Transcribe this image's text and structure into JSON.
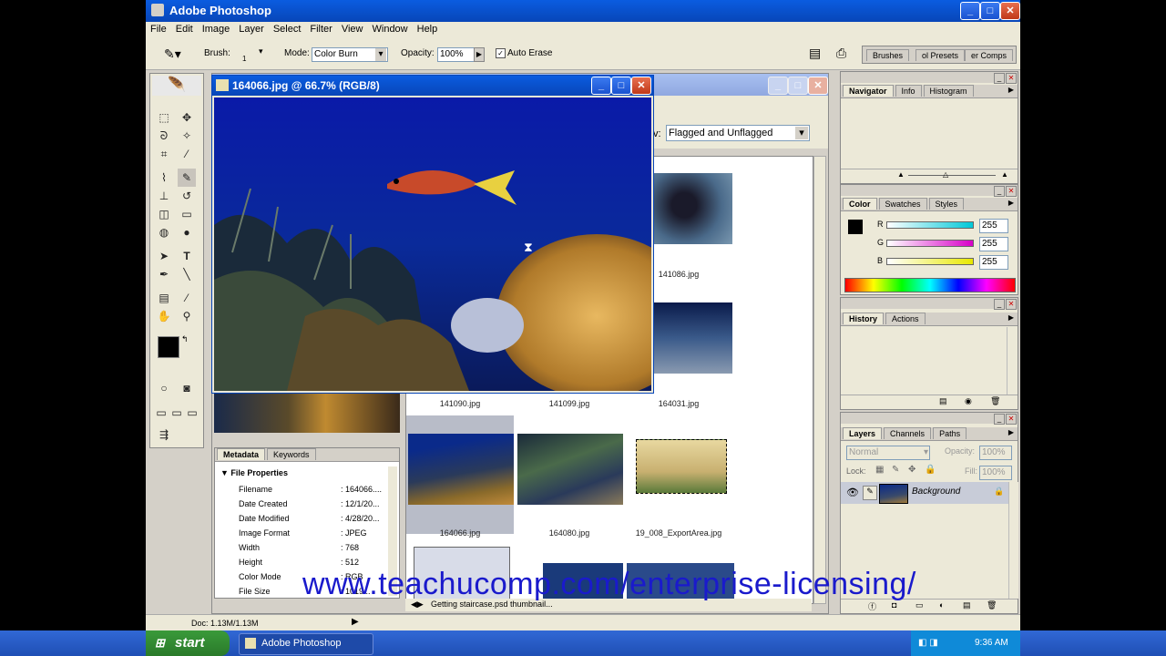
{
  "app": {
    "title": "Adobe Photoshop"
  },
  "menu": [
    "File",
    "Edit",
    "Image",
    "Layer",
    "Select",
    "Filter",
    "View",
    "Window",
    "Help"
  ],
  "options": {
    "brush_label": "Brush:",
    "brush_size": "1",
    "mode_label": "Mode:",
    "mode_value": "Color Burn",
    "opacity_label": "Opacity:",
    "opacity_value": "100%",
    "auto_erase": "Auto Erase",
    "wells": [
      "Brushes",
      "ol Presets",
      "er Comps"
    ]
  },
  "document": {
    "title": "164066.jpg @ 66.7% (RGB/8)"
  },
  "browser": {
    "filter_label": "v:",
    "filter_value": "Flagged and Unflagged",
    "thumbs": [
      {
        "name": "141086.jpg"
      },
      {
        "name": "141090.jpg"
      },
      {
        "name": "141099.jpg"
      },
      {
        "name": "164031.jpg"
      },
      {
        "name": "164066.jpg"
      },
      {
        "name": "164080.jpg"
      },
      {
        "name": "19_008_ExportArea.jpg"
      }
    ],
    "status": "Getting staircase.psd thumbnail..."
  },
  "metadata": {
    "tabs": [
      "Metadata",
      "Keywords"
    ],
    "section": "File Properties",
    "rows": [
      {
        "k": "Filename",
        "v": ": 164066...."
      },
      {
        "k": "Date Created",
        "v": ": 12/1/20..."
      },
      {
        "k": "Date Modified",
        "v": ": 4/28/20..."
      },
      {
        "k": "Image Format",
        "v": ": JPEG"
      },
      {
        "k": "Width",
        "v": ": 768"
      },
      {
        "k": "Height",
        "v": ": 512"
      },
      {
        "k": "Color Mode",
        "v": ": RGB"
      },
      {
        "k": "File Size",
        "v": ": 1019..."
      }
    ]
  },
  "navigator": {
    "tabs": [
      "Navigator",
      "Info",
      "Histogram"
    ]
  },
  "color": {
    "tabs": [
      "Color",
      "Swatches",
      "Styles"
    ],
    "channels": [
      {
        "name": "R",
        "value": "255",
        "color": "#00c8d8"
      },
      {
        "name": "G",
        "value": "255",
        "color": "#d800c8"
      },
      {
        "name": "B",
        "value": "255",
        "color": "#e8e800"
      }
    ]
  },
  "history": {
    "tabs": [
      "History",
      "Actions"
    ]
  },
  "layers": {
    "tabs": [
      "Layers",
      "Channels",
      "Paths"
    ],
    "blend": "Normal",
    "opacity_label": "Opacity:",
    "opacity_value": "100%",
    "lock_label": "Lock:",
    "fill_label": "Fill:",
    "fill_value": "100%",
    "layer_name": "Background"
  },
  "statusbar": {
    "doc": "Doc: 1.13M/1.13M"
  },
  "watermark": "www.teachucomp.com/enterprise-licensing/",
  "taskbar": {
    "start": "start",
    "task": "Adobe Photoshop",
    "clock": "9:36 AM"
  }
}
